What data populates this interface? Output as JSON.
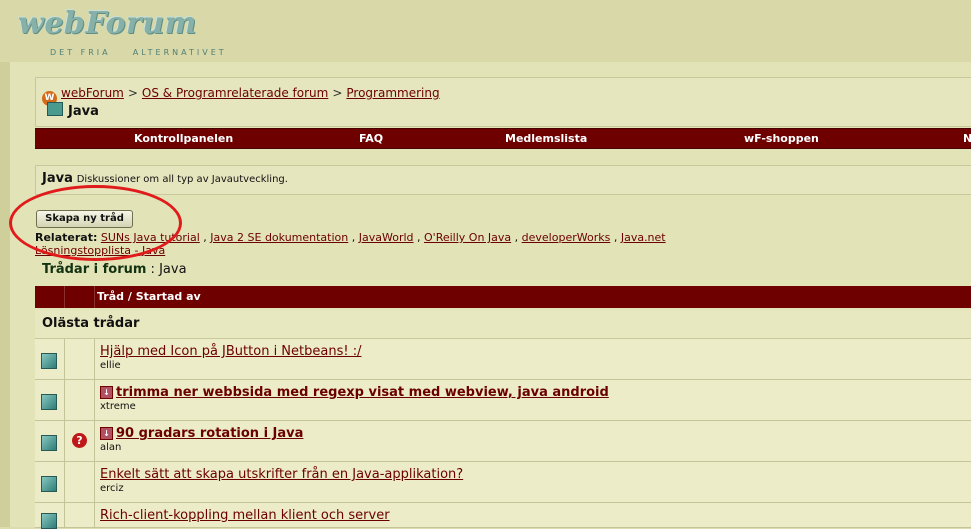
{
  "logo": {
    "title": "webForum",
    "tagline": "DET FRIA    ALTERNATIVET"
  },
  "breadcrumb": {
    "home": "webForum",
    "level1": "OS & Programrelaterade forum",
    "level2": "Programmering",
    "current": "Java"
  },
  "navbar": {
    "items": [
      "Kontrollpanelen",
      "FAQ",
      "Medlemslista",
      "wF-shoppen",
      "N"
    ]
  },
  "forum": {
    "name": "Java",
    "description": "Diskussioner om all typ av Javautveckling."
  },
  "new_thread_button": "Skapa ny tråd",
  "related": {
    "label": "Relaterat:",
    "links": [
      "SUNs Java tutorial",
      "Java 2 SE dokumentation",
      "JavaWorld",
      "O'Reilly On Java",
      "developerWorks",
      "Java.net",
      "Lösningstopplista - Java"
    ]
  },
  "threads_header": {
    "label": "Trådar i forum",
    "forum": "Java"
  },
  "table_header": {
    "thread_col": "Tråd / Startad av"
  },
  "unread_label": "Olästa trådar",
  "threads": [
    {
      "title": "Hjälp med Icon på JButton i Netbeans! :/",
      "author": "ellie",
      "bold": false,
      "question": false,
      "attachment": false
    },
    {
      "title": "trimma ner webbsida med regexp visat med webview, java android",
      "author": "xtreme",
      "bold": true,
      "question": false,
      "attachment": true
    },
    {
      "title": "90 gradars rotation i Java",
      "author": "alan",
      "bold": true,
      "question": true,
      "attachment": true
    },
    {
      "title": "Enkelt sätt att skapa utskrifter från en Java-applikation?",
      "author": "erciz",
      "bold": false,
      "question": false,
      "attachment": false
    },
    {
      "title": "Rich-client-koppling mellan klient och server",
      "author": "",
      "bold": false,
      "question": false,
      "attachment": false
    }
  ],
  "colors": {
    "dark_red": "#6e0000",
    "background": "#dcdcaf",
    "annotation_red": "#e01b1b"
  }
}
